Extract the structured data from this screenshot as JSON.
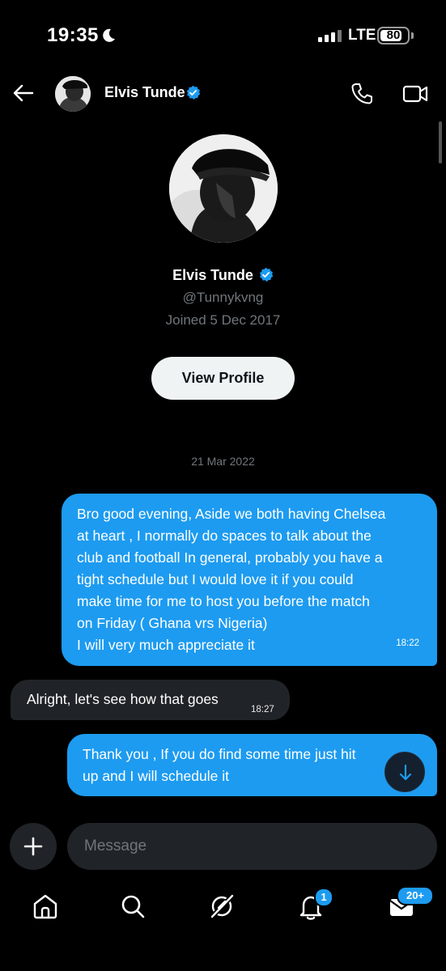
{
  "status_bar": {
    "time": "19:35",
    "network": "LTE",
    "battery": "80",
    "battery_level": 0.8
  },
  "header": {
    "name": "Elvis Tunde"
  },
  "profile": {
    "name": "Elvis Tunde",
    "handle": "@Tunnykvng",
    "joined": "Joined 5 Dec 2017",
    "view_profile_label": "View Profile"
  },
  "date_separator": "21 Mar 2022",
  "messages": [
    {
      "direction": "sent",
      "text": "Bro good evening, Aside we both having Chelsea\nat heart , I normally do spaces to talk about the\nclub and football In general, probably you have a\ntight schedule but I would love it if you could\nmake time for me to host you before the match\non Friday ( Ghana vrs Nigeria)\nI will very much appreciate it",
      "time": "18:22"
    },
    {
      "direction": "received",
      "text": "Alright, let's see how that goes",
      "time": "18:27"
    },
    {
      "direction": "sent",
      "text": "Thank you , If you do find some time just hit\nup and I will schedule it",
      "time": ""
    }
  ],
  "composer": {
    "placeholder": "Message"
  },
  "bottom_nav": {
    "items": [
      "home-icon",
      "search-icon",
      "grok-icon",
      "notifications-icon",
      "messages-icon"
    ],
    "notifications_badge": "1",
    "messages_badge": "20+"
  },
  "colors": {
    "accent": "#1d9bf0",
    "background": "#000000",
    "bubble_received": "#202327"
  }
}
